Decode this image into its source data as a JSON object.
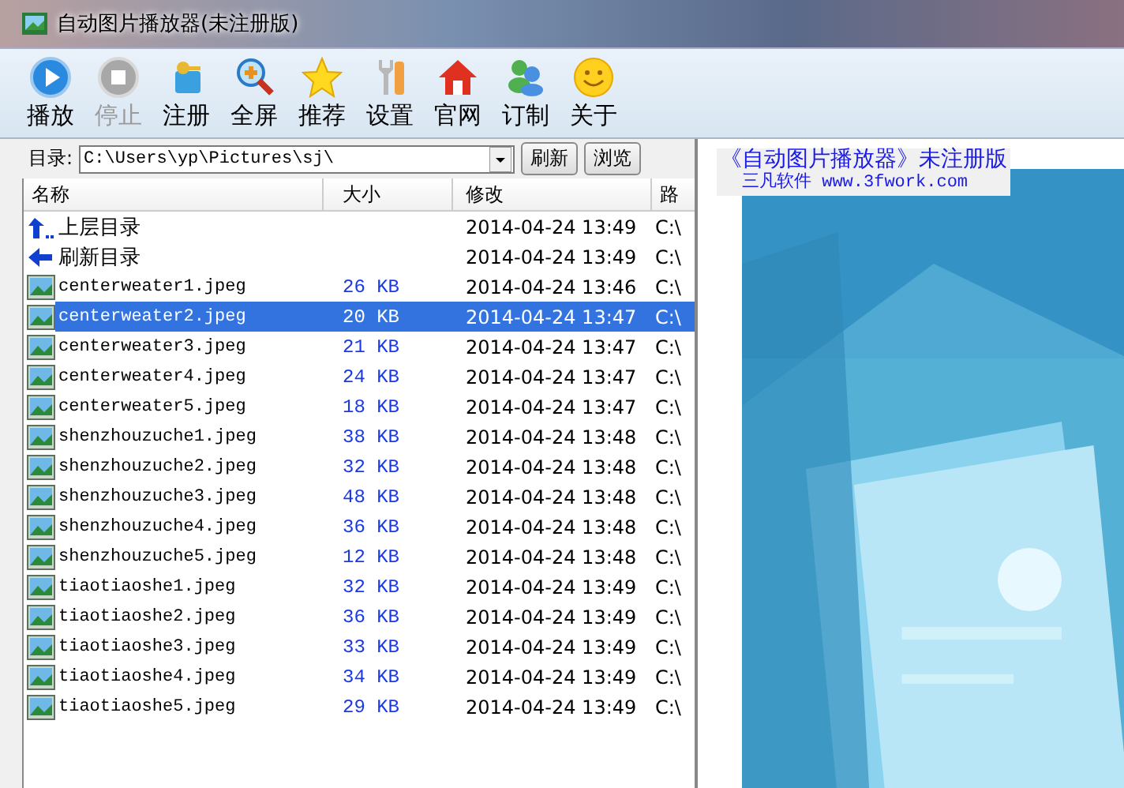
{
  "window": {
    "title": "自动图片播放器(未注册版)"
  },
  "toolbar": [
    {
      "label": "播放",
      "kind": "play",
      "disabled": false
    },
    {
      "label": "停止",
      "kind": "stop",
      "disabled": true
    },
    {
      "label": "注册",
      "kind": "key",
      "disabled": false
    },
    {
      "label": "全屏",
      "kind": "zoom",
      "disabled": false
    },
    {
      "label": "推荐",
      "kind": "star",
      "disabled": false
    },
    {
      "label": "设置",
      "kind": "tools",
      "disabled": false
    },
    {
      "label": "官网",
      "kind": "home",
      "disabled": false
    },
    {
      "label": "订制",
      "kind": "people",
      "disabled": false
    },
    {
      "label": "关于",
      "kind": "smile",
      "disabled": false
    }
  ],
  "directory": {
    "label": "目录:",
    "value": "C:\\Users\\yp\\Pictures\\sj\\",
    "buttons": [
      "刷新",
      "浏览"
    ]
  },
  "table": {
    "columns": [
      "名称",
      "大小",
      "修改",
      "路"
    ],
    "rows": [
      {
        "kind": "up",
        "name": "上层目录",
        "modified": "2014-04-24 13:49",
        "path": "C:\\",
        "selected": false
      },
      {
        "kind": "refresh",
        "name": "刷新目录",
        "modified": "2014-04-24 13:49",
        "path": "C:\\",
        "selected": false
      },
      {
        "kind": "file",
        "name": "centerweater1.jpeg",
        "size": "26 KB",
        "modified": "2014-04-24 13:46",
        "path": "C:\\",
        "selected": false
      },
      {
        "kind": "file",
        "name": "centerweater2.jpeg",
        "size": "20 KB",
        "modified": "2014-04-24 13:47",
        "path": "C:\\",
        "selected": true
      },
      {
        "kind": "file",
        "name": "centerweater3.jpeg",
        "size": "21 KB",
        "modified": "2014-04-24 13:47",
        "path": "C:\\",
        "selected": false
      },
      {
        "kind": "file",
        "name": "centerweater4.jpeg",
        "size": "24 KB",
        "modified": "2014-04-24 13:47",
        "path": "C:\\",
        "selected": false
      },
      {
        "kind": "file",
        "name": "centerweater5.jpeg",
        "size": "18 KB",
        "modified": "2014-04-24 13:47",
        "path": "C:\\",
        "selected": false
      },
      {
        "kind": "file",
        "name": "shenzhouzuche1.jpeg",
        "size": "38 KB",
        "modified": "2014-04-24 13:48",
        "path": "C:\\",
        "selected": false
      },
      {
        "kind": "file",
        "name": "shenzhouzuche2.jpeg",
        "size": "32 KB",
        "modified": "2014-04-24 13:48",
        "path": "C:\\",
        "selected": false
      },
      {
        "kind": "file",
        "name": "shenzhouzuche3.jpeg",
        "size": "48 KB",
        "modified": "2014-04-24 13:48",
        "path": "C:\\",
        "selected": false
      },
      {
        "kind": "file",
        "name": "shenzhouzuche4.jpeg",
        "size": "36 KB",
        "modified": "2014-04-24 13:48",
        "path": "C:\\",
        "selected": false
      },
      {
        "kind": "file",
        "name": "shenzhouzuche5.jpeg",
        "size": "12 KB",
        "modified": "2014-04-24 13:48",
        "path": "C:\\",
        "selected": false
      },
      {
        "kind": "file",
        "name": "tiaotiaoshe1.jpeg",
        "size": "32 KB",
        "modified": "2014-04-24 13:49",
        "path": "C:\\",
        "selected": false
      },
      {
        "kind": "file",
        "name": "tiaotiaoshe2.jpeg",
        "size": "36 KB",
        "modified": "2014-04-24 13:49",
        "path": "C:\\",
        "selected": false
      },
      {
        "kind": "file",
        "name": "tiaotiaoshe3.jpeg",
        "size": "33 KB",
        "modified": "2014-04-24 13:49",
        "path": "C:\\",
        "selected": false
      },
      {
        "kind": "file",
        "name": "tiaotiaoshe4.jpeg",
        "size": "34 KB",
        "modified": "2014-04-24 13:49",
        "path": "C:\\",
        "selected": false
      },
      {
        "kind": "file",
        "name": "tiaotiaoshe5.jpeg",
        "size": "29 KB",
        "modified": "2014-04-24 13:49",
        "path": "C:\\",
        "selected": false
      }
    ]
  },
  "preview": {
    "kind": "picture",
    "overlay_title": "《自动图片播放器》未注册版",
    "overlay_line": "三凡软件 www.3fwork.com"
  }
}
